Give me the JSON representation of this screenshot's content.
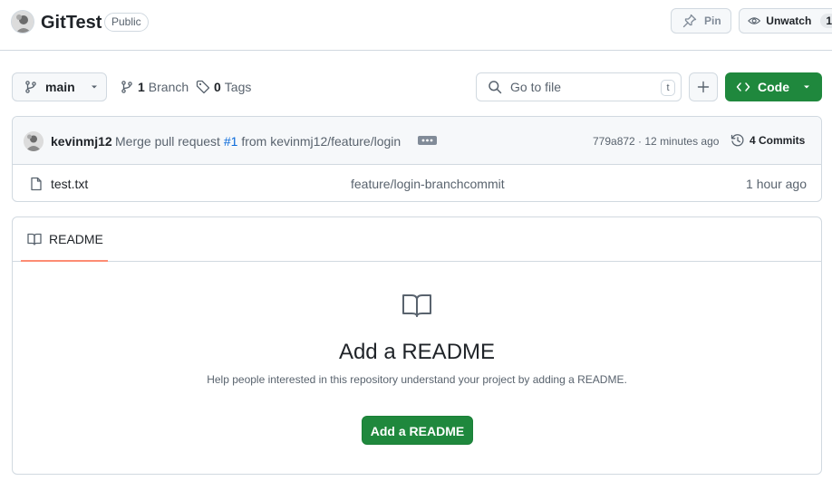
{
  "repo": {
    "name": "GitTest",
    "visibility": "Public"
  },
  "header_actions": {
    "pin_label": "Pin",
    "unwatch_label": "Unwatch",
    "watch_count": "1"
  },
  "toolbar": {
    "branch_name": "main",
    "branch_count": "1",
    "branch_label": "Branch",
    "tag_count": "0",
    "tag_label": "Tags",
    "search_placeholder": "Go to file",
    "search_shortcut": "t",
    "code_label": "Code"
  },
  "latest_commit": {
    "author": "kevinmj12",
    "message_prefix": "Merge pull request",
    "pr_ref": "#1",
    "message_suffix": "from kevinmj12/feature/login",
    "sha_time": "779a872 · 12 minutes ago",
    "commits_label": "4 Commits"
  },
  "files": [
    {
      "name": "test.txt",
      "message": "feature/login-branchcommit",
      "age": "1 hour ago"
    }
  ],
  "readme": {
    "tab_label": "README",
    "title": "Add a README",
    "help_text": "Help people interested in this repository understand your project by adding a README.",
    "button_label": "Add a README"
  },
  "colors": {
    "accent_green": "#1f883d",
    "link_blue": "#0969da",
    "tab_underline": "#fd8c73",
    "border": "#d1d9e0"
  },
  "icons": [
    "avatar",
    "pin-icon",
    "eye-icon",
    "branch-icon",
    "tag-icon",
    "search-icon",
    "plus-icon",
    "code-icon",
    "chevron-down-icon",
    "history-icon",
    "file-icon",
    "book-icon",
    "kebab-horizontal-icon"
  ]
}
